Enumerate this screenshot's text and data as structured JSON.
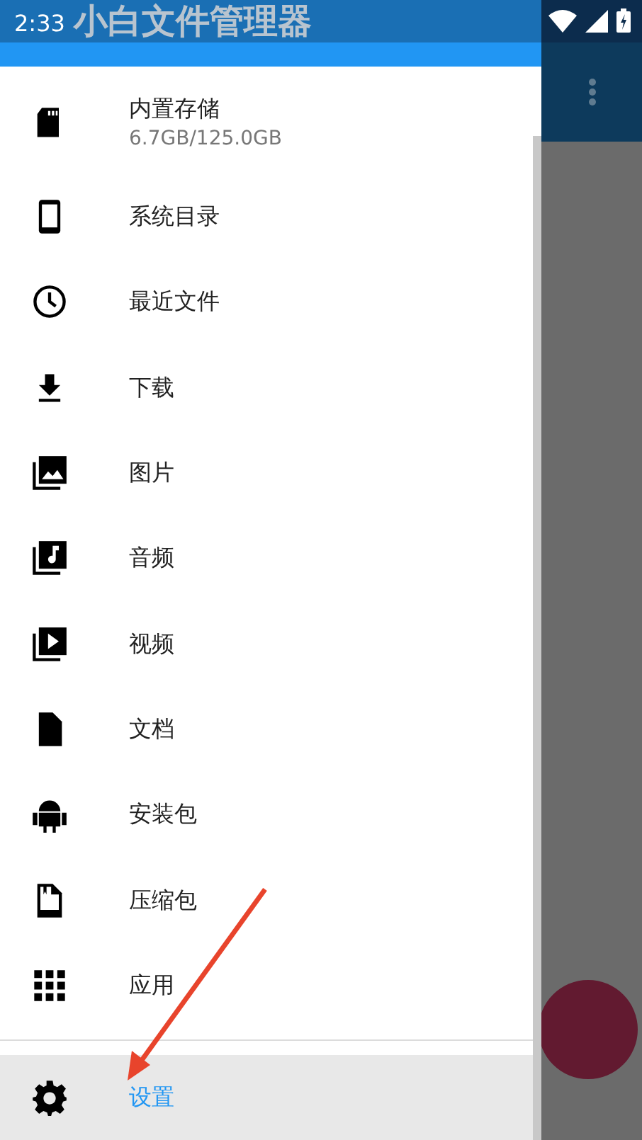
{
  "status_bar": {
    "time": "2:33"
  },
  "app_title": "小白文件管理器",
  "drawer": {
    "items": [
      {
        "label": "内置存储",
        "sublabel": "6.7GB/125.0GB",
        "selected": false
      },
      {
        "label": "系统目录",
        "selected": false
      },
      {
        "label": "最近文件",
        "selected": false
      },
      {
        "label": "下载",
        "selected": false
      },
      {
        "label": "图片",
        "selected": false
      },
      {
        "label": "音频",
        "selected": false
      },
      {
        "label": "视频",
        "selected": false
      },
      {
        "label": "文档",
        "selected": false
      },
      {
        "label": "安装包",
        "selected": false
      },
      {
        "label": "压缩包",
        "selected": false
      },
      {
        "label": "应用",
        "selected": false
      }
    ],
    "footer_items": [
      {
        "label": "设置",
        "selected": true
      }
    ]
  }
}
